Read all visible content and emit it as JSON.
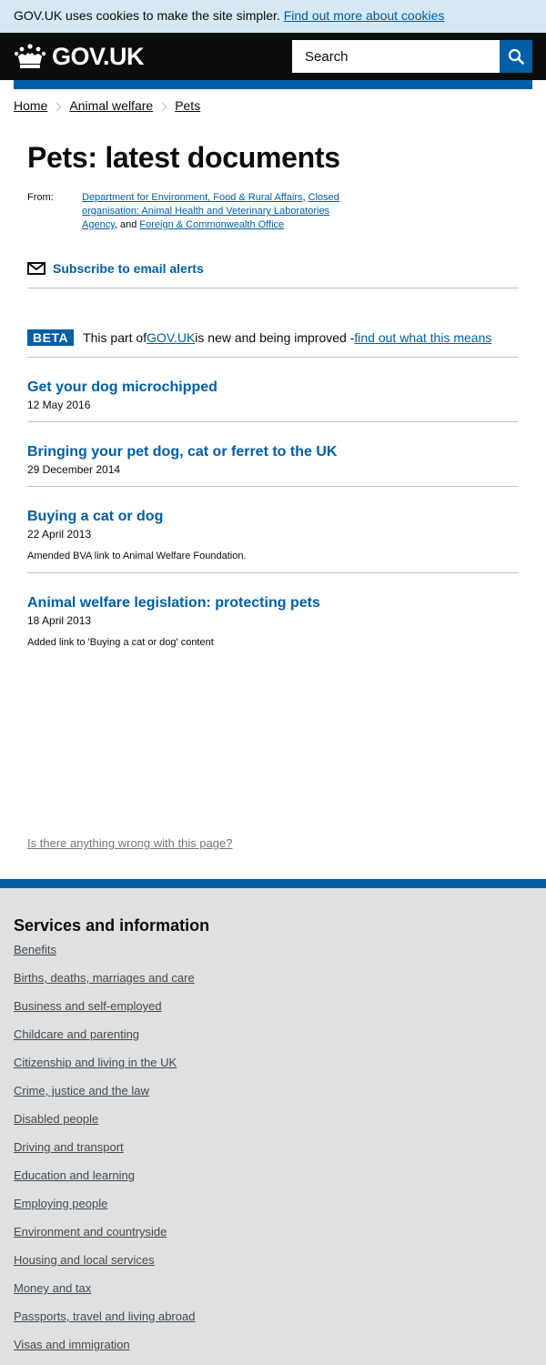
{
  "cookie_banner": {
    "text": "GOV.UK uses cookies to make the site simpler.",
    "link": "Find out more about cookies"
  },
  "header": {
    "logo_text": "GOV.UK",
    "logo_icon": "crown-icon",
    "search_placeholder": "Search",
    "search_icon": "search-icon"
  },
  "breadcrumbs": [
    "Home",
    "Animal welfare",
    "Pets"
  ],
  "page": {
    "title": "Pets: latest documents",
    "from_label": "From:",
    "orgs": [
      "Department for Environment, Food & Rural Affairs",
      "Closed organisation: Animal Health and Veterinary Laboratories Agency",
      "Foreign & Commonwealth Office"
    ],
    "org_sep_1": ", ",
    "org_sep_2": ", and ",
    "subscribe": "Subscribe to email alerts"
  },
  "beta": {
    "tag": "BETA",
    "text_before": "This part of ",
    "govuk_link": "GOV.UK",
    "text_after": " is new and being improved - ",
    "link": "find out what this means"
  },
  "documents": [
    {
      "title": "Get your dog microchipped",
      "date": "12 May 2016",
      "note": ""
    },
    {
      "title": "Bringing your pet dog, cat or ferret to the UK",
      "date": "29 December 2014",
      "note": ""
    },
    {
      "title": "Buying a cat or dog",
      "date": "22 April 2013",
      "note": "Amended BVA link to Animal Welfare Foundation."
    },
    {
      "title": "Animal welfare legislation: protecting pets",
      "date": "18 April 2013",
      "note": "Added link to 'Buying a cat or dog' content"
    }
  ],
  "report_link": "Is there anything wrong with this page?",
  "footer": {
    "title": "Services and information",
    "links": [
      "Benefits",
      "Births, deaths, marriages and care",
      "Business and self-employed",
      "Childcare and parenting",
      "Citizenship and living in the UK",
      "Crime, justice and the law",
      "Disabled people",
      "Driving and transport",
      "Education and learning",
      "Employing people",
      "Environment and countryside",
      "Housing and local services",
      "Money and tax",
      "Passports, travel and living abroad",
      "Visas and immigration"
    ]
  },
  "colors": {
    "brand_blue": "#005ea5",
    "header_black": "#0b0c0c",
    "cookie_bg": "#d5e8f3",
    "footer_bg": "#dee0e2"
  }
}
